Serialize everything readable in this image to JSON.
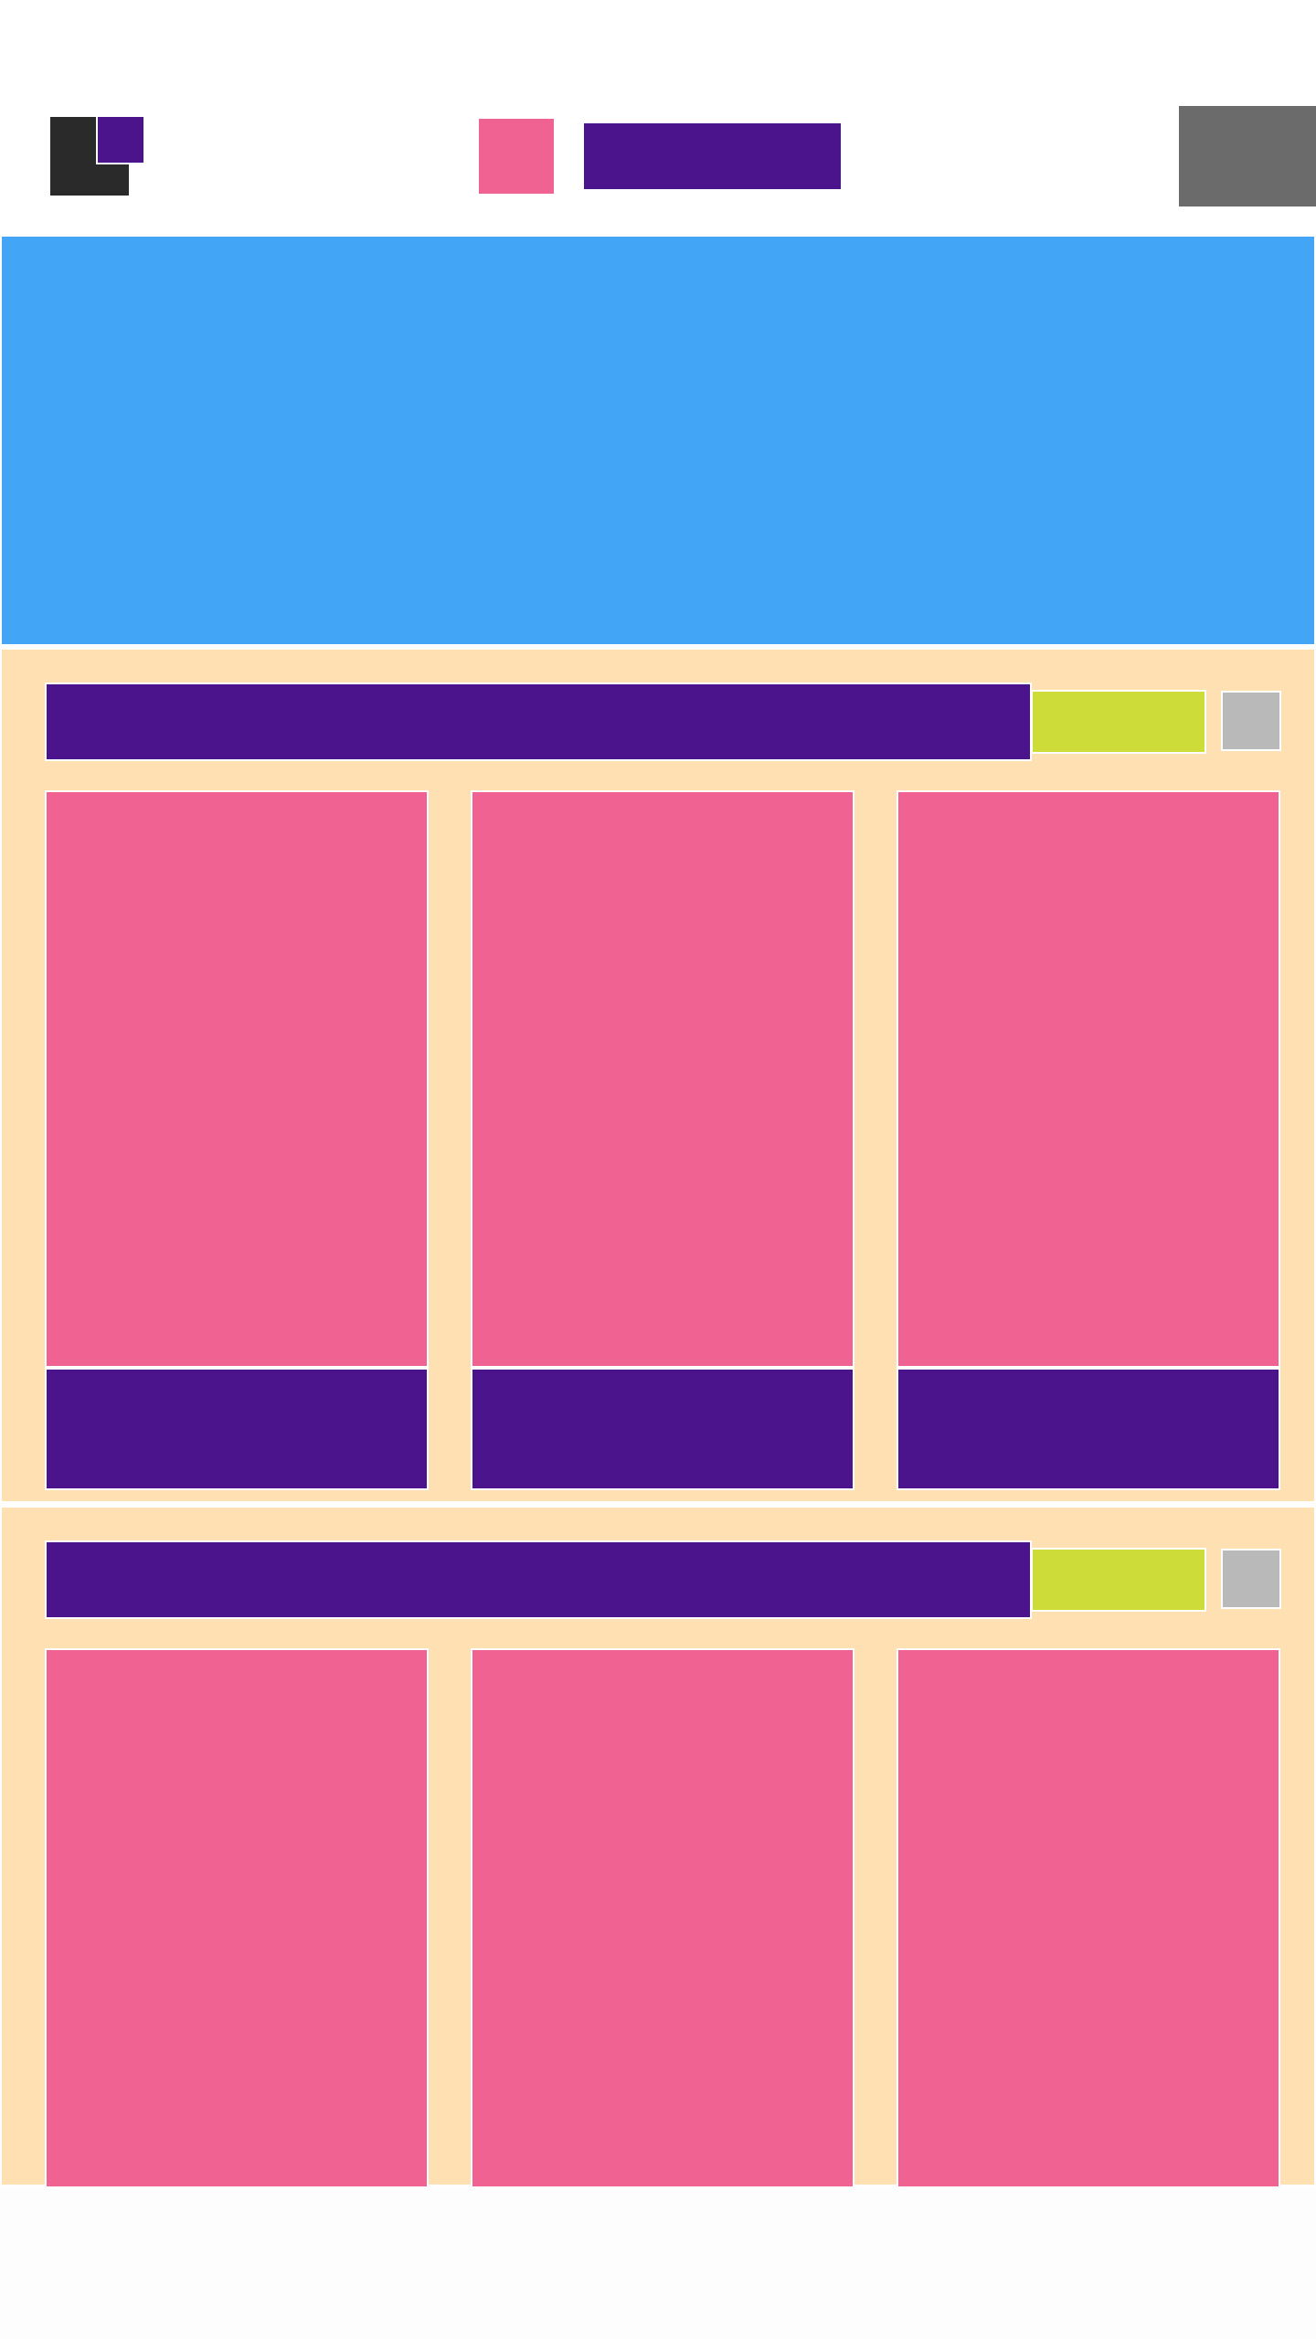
{
  "colors": {
    "page_background": "#fdfdfe",
    "header_background": "#ffffff",
    "logo_dark": "#2a2a2a",
    "primary": "#4b148c",
    "accent": "#f06292",
    "hero": "#42a5f5",
    "section_background": "#ffe0b2",
    "pill": "#cddc39",
    "square_button": "#b9b9b9",
    "header_action": "#6b6b6b"
  },
  "header": {
    "logo_icon": "logo-icon",
    "nav_icon": "nav-icon",
    "action_icon": "menu-button"
  },
  "sections": [
    {
      "cards_visible": 3,
      "has_partial_card": true
    },
    {
      "cards_visible": 3,
      "has_partial_card": true
    }
  ]
}
